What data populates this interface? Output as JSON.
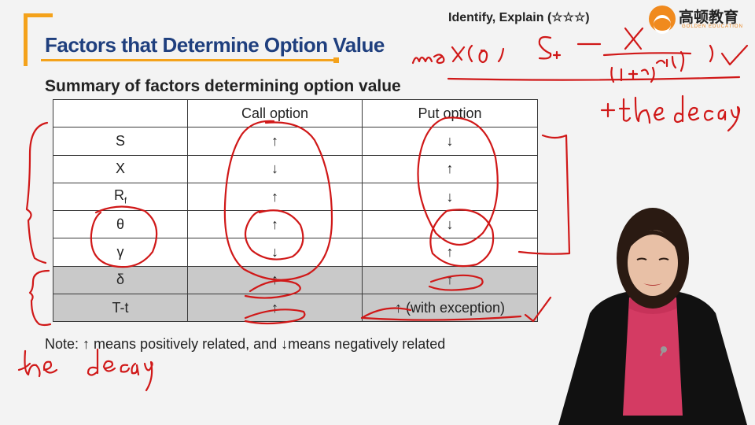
{
  "slide": {
    "title": "Factors that Determine Option Value",
    "tag": "Identify, Explain (☆☆☆)",
    "logo": {
      "name": "高顿教育",
      "sub": "GOLDEN EDUCATION"
    },
    "subtitle": "Summary of factors determining option value",
    "table": {
      "headers": [
        "",
        "Call option",
        "Put option"
      ],
      "rows": [
        {
          "factor": "S",
          "call": "↑",
          "put": "↓",
          "shaded": false
        },
        {
          "factor": "X",
          "call": "↓",
          "put": "↑",
          "shaded": false
        },
        {
          "factor": "R",
          "factor_sub": "f",
          "call": "↑",
          "put": "↓",
          "shaded": false
        },
        {
          "factor": "θ",
          "call": "↑",
          "put": "↓",
          "shaded": false
        },
        {
          "factor": "γ",
          "call": "↓",
          "put": "↑",
          "shaded": false
        },
        {
          "factor": "δ",
          "call": "↑",
          "put": "↑",
          "shaded": true
        },
        {
          "factor": "T-t",
          "call": "↑",
          "put": "↑ (with exception)",
          "shaded": true
        }
      ]
    },
    "note": "Note: ↑ means positively related, and ↓means negatively related"
  },
  "colors": {
    "title": "#1f3f7e",
    "accent": "#f4a21b",
    "ink": "#d01818",
    "shade": "#c9c9c9"
  }
}
